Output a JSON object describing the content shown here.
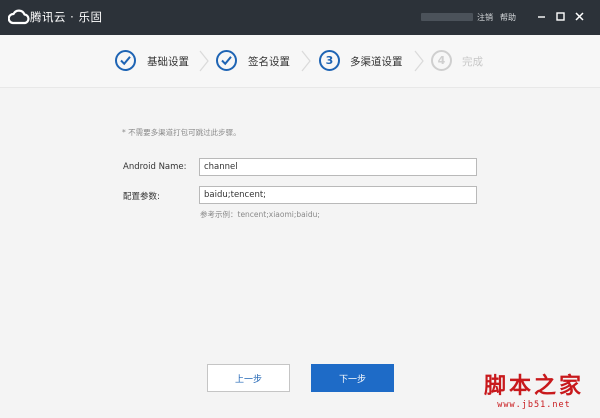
{
  "window": {
    "app_title": "腾讯云 · 乐固",
    "logout_label": "注销",
    "help_label": "帮助"
  },
  "steps": [
    {
      "label": "基础设置",
      "state": "done"
    },
    {
      "label": "签名设置",
      "state": "done"
    },
    {
      "label": "多渠道设置",
      "state": "current",
      "number": "3"
    },
    {
      "label": "完成",
      "state": "pending",
      "number": "4"
    }
  ],
  "form": {
    "note": "* 不需要多渠道打包可跳过此步骤。",
    "android_name_label": "Android Name:",
    "android_name_value": "channel",
    "config_label": "配置参数:",
    "config_value": "baidu;tencent;",
    "hint": "参考示例：tencent;xiaomi;baidu;"
  },
  "buttons": {
    "prev_label": "上一步",
    "next_label": "下一步"
  },
  "watermark": {
    "title": "脚本之家",
    "url": "www.jb51.net"
  },
  "colors": {
    "titlebar": "#2c3239",
    "accent": "#1e64b4",
    "primary_button": "#1e6bc7",
    "watermark": "#c8191c"
  },
  "icons": {
    "logo": "cloud-icon",
    "step_done": "check-icon",
    "separator": "chevron-right-icon",
    "minimize": "minimize-icon",
    "maximize": "maximize-icon",
    "close": "close-icon"
  }
}
